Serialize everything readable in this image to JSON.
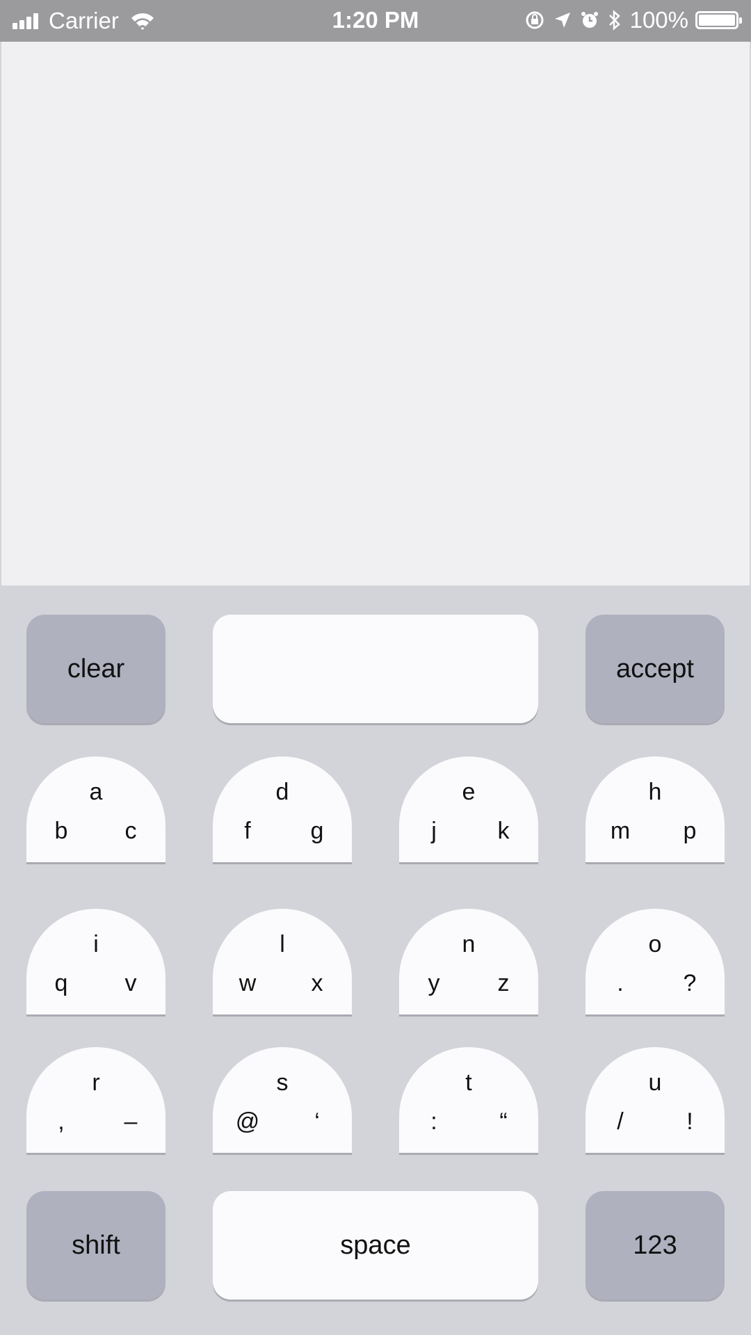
{
  "status_bar": {
    "carrier": "Carrier",
    "time": "1:20 PM",
    "battery_percent": "100%",
    "battery_level": 1.0,
    "icons": [
      "signal-icon",
      "wifi-icon",
      "orientation-lock-icon",
      "location-icon",
      "alarm-icon",
      "bluetooth-icon",
      "battery-icon"
    ]
  },
  "keyboard": {
    "top_row": {
      "clear_label": "clear",
      "input_value": "",
      "accept_label": "accept"
    },
    "letter_keys": [
      {
        "top": "a",
        "left": "b",
        "right": "c"
      },
      {
        "top": "d",
        "left": "f",
        "right": "g"
      },
      {
        "top": "e",
        "left": "j",
        "right": "k"
      },
      {
        "top": "h",
        "left": "m",
        "right": "p"
      },
      {
        "top": "i",
        "left": "q",
        "right": "v"
      },
      {
        "top": "l",
        "left": "w",
        "right": "x"
      },
      {
        "top": "n",
        "left": "y",
        "right": "z"
      },
      {
        "top": "o",
        "left": ".",
        "right": "?"
      },
      {
        "top": "r",
        "left": ",",
        "right": "–"
      },
      {
        "top": "s",
        "left": "@",
        "right": "‘"
      },
      {
        "top": "t",
        "left": ":",
        "right": "“"
      },
      {
        "top": "u",
        "left": "/",
        "right": "!"
      }
    ],
    "bottom_row": {
      "shift_label": "shift",
      "space_label": "space",
      "numbers_label": "123"
    }
  },
  "colors": {
    "keyboard_bg": "#d3d4d9",
    "function_key": "#afb1bf",
    "letter_key": "#fbfbfd",
    "content_bg": "#f0f0f2",
    "status_bar": "#9b9b9e"
  }
}
